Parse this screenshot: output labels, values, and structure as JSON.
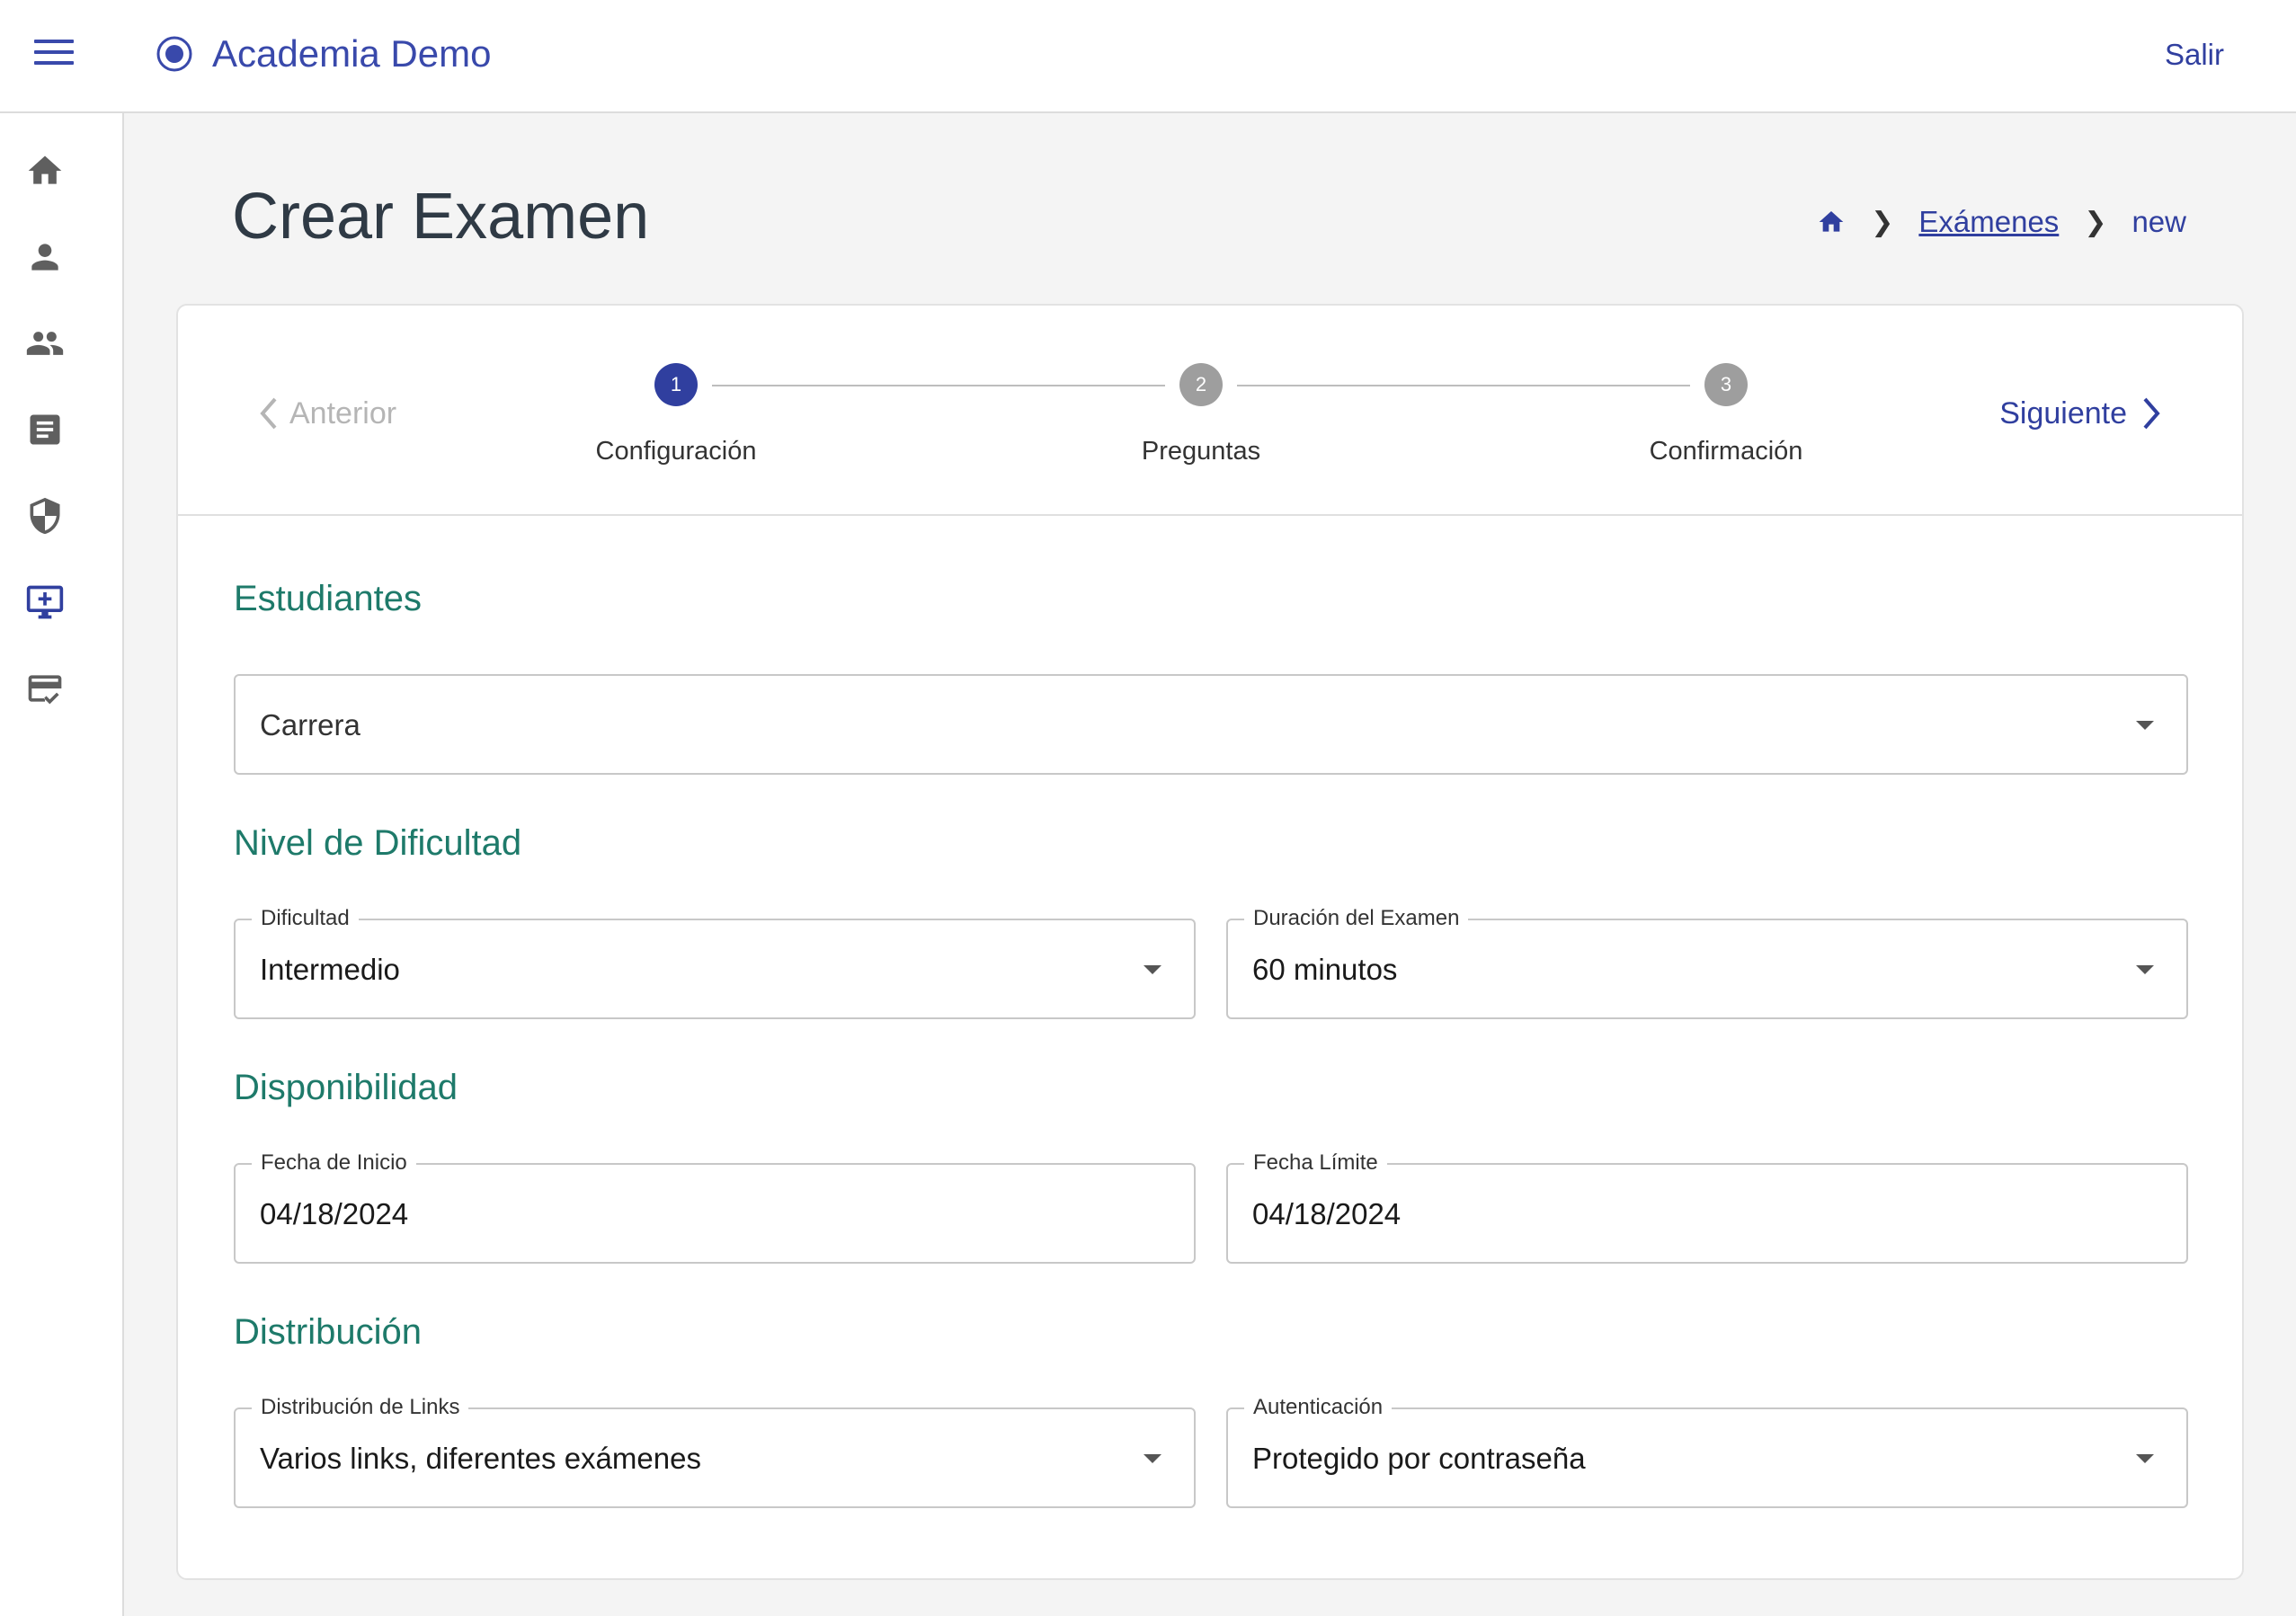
{
  "app": {
    "title": "Academia Demo",
    "logout_label": "Salir"
  },
  "sidebar": {
    "items": [
      {
        "icon": "home-icon"
      },
      {
        "icon": "person-icon"
      },
      {
        "icon": "group-icon"
      },
      {
        "icon": "document-icon"
      },
      {
        "icon": "shield-icon"
      },
      {
        "icon": "add-screen-icon",
        "active": true
      },
      {
        "icon": "card-check-icon"
      }
    ]
  },
  "header": {
    "title": "Crear Examen",
    "breadcrumb": {
      "link": "Exámenes",
      "current": "new"
    }
  },
  "stepper": {
    "prev_label": "Anterior",
    "next_label": "Siguiente",
    "steps": [
      {
        "number": "1",
        "label": "Configuración",
        "active": true
      },
      {
        "number": "2",
        "label": "Preguntas",
        "active": false
      },
      {
        "number": "3",
        "label": "Confirmación",
        "active": false
      }
    ]
  },
  "sections": {
    "students": {
      "title": "Estudiantes",
      "career_placeholder": "Carrera"
    },
    "difficulty": {
      "title": "Nivel de Dificultad",
      "difficulty_label": "Dificultad",
      "difficulty_value": "Intermedio",
      "duration_label": "Duración del Examen",
      "duration_value": "60 minutos"
    },
    "availability": {
      "title": "Disponibilidad",
      "start_label": "Fecha de Inicio",
      "start_value": "04/18/2024",
      "end_label": "Fecha Límite",
      "end_value": "04/18/2024"
    },
    "distribution": {
      "title": "Distribución",
      "links_label": "Distribución de Links",
      "links_value": "Varios links, diferentes exámenes",
      "auth_label": "Autenticación",
      "auth_value": "Protegido por contraseña"
    }
  },
  "colors": {
    "primary": "#303f9f",
    "section": "#1e7a6a"
  }
}
